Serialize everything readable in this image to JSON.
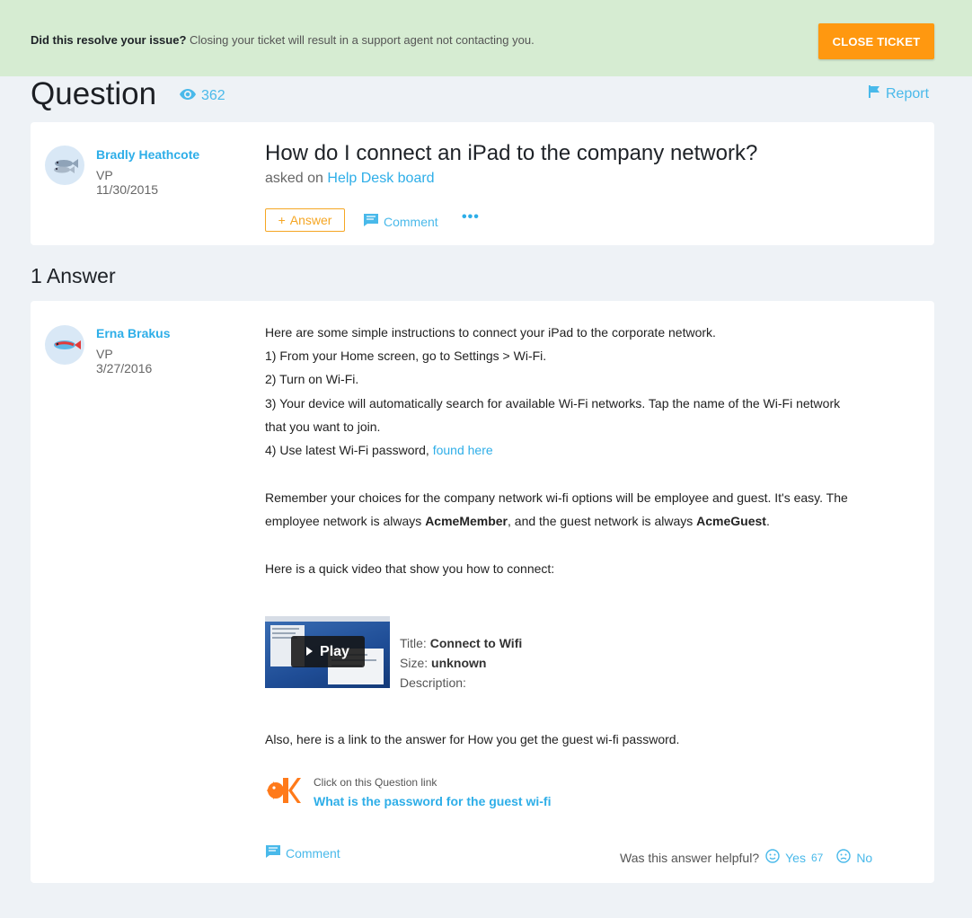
{
  "banner": {
    "question": "Did this resolve your issue?",
    "message": " Closing your ticket will result in a support agent not contacting you.",
    "close_label": "CLOSE TICKET"
  },
  "page": {
    "title": "Question",
    "views": "362",
    "report_label": "Report"
  },
  "question": {
    "author": {
      "name": "Bradly Heathcote",
      "role": "VP",
      "date": "11/30/2015"
    },
    "title": "How do I connect an iPad to the company network?",
    "asked_prefix": "asked on",
    "board": "Help Desk board",
    "answer_label": "Answer",
    "comment_label": "Comment",
    "more_label": "•••"
  },
  "answers_heading": "1 Answer",
  "answer": {
    "author": {
      "name": "Erna Brakus",
      "role": "VP",
      "date": "3/27/2016"
    },
    "intro": "Here are some simple instructions to connect your iPad to the corporate network.",
    "steps": [
      "1) From your Home screen, go to Settings > Wi-Fi.",
      "2) Turn on Wi-Fi.",
      "3) Your device will automatically search for available Wi-Fi networks. Tap the name of the Wi-Fi network",
      "that you want to join.",
      "4) Use latest Wi-Fi password, "
    ],
    "step4_link": "found here",
    "remember_line1": "Remember your choices for the company network wi-fi options will be employee and guest. It's easy. The",
    "remember_line2_a": "employee network is always ",
    "remember_member": "AcmeMember",
    "remember_line2_b": ", and the guest network is always ",
    "remember_guest": "AcmeGuest",
    "remember_line2_c": ".",
    "video_intro": "Here is a quick video that show you how to connect:",
    "video": {
      "play_label": "Play",
      "title_label": "Title: ",
      "title_value": "Connect to Wifi",
      "size_label": "Size: ",
      "size_value": "unknown",
      "description_label": "Description:"
    },
    "link_intro": "Also, here is a link to the answer for How you get the guest wi-fi password.",
    "kb_caption": "Click on this Question link",
    "kb_link": "What is the password for the guest wi-fi",
    "comment_label": "Comment",
    "helpful_label": "Was this answer helpful?",
    "yes_label": "Yes",
    "yes_count": "67",
    "no_label": "No"
  },
  "colors": {
    "accent": "#2eaee8",
    "close_button": "#ff9810",
    "answer_button": "#f5a623",
    "banner": "#d6ecd2"
  }
}
